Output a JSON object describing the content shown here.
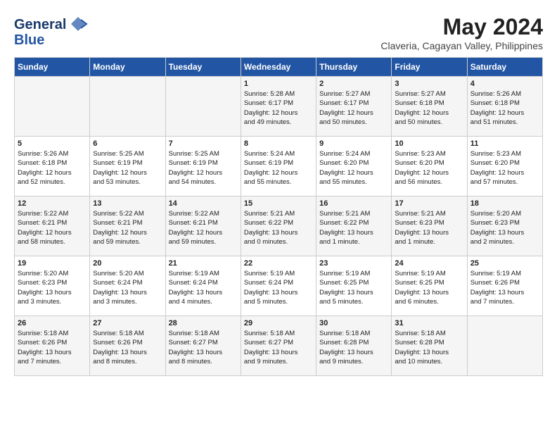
{
  "header": {
    "logo_line1": "General",
    "logo_line2": "Blue",
    "month_year": "May 2024",
    "location": "Claveria, Cagayan Valley, Philippines"
  },
  "days_of_week": [
    "Sunday",
    "Monday",
    "Tuesday",
    "Wednesday",
    "Thursday",
    "Friday",
    "Saturday"
  ],
  "weeks": [
    [
      {
        "day": "",
        "info": ""
      },
      {
        "day": "",
        "info": ""
      },
      {
        "day": "",
        "info": ""
      },
      {
        "day": "1",
        "info": "Sunrise: 5:28 AM\nSunset: 6:17 PM\nDaylight: 12 hours\nand 49 minutes."
      },
      {
        "day": "2",
        "info": "Sunrise: 5:27 AM\nSunset: 6:17 PM\nDaylight: 12 hours\nand 50 minutes."
      },
      {
        "day": "3",
        "info": "Sunrise: 5:27 AM\nSunset: 6:18 PM\nDaylight: 12 hours\nand 50 minutes."
      },
      {
        "day": "4",
        "info": "Sunrise: 5:26 AM\nSunset: 6:18 PM\nDaylight: 12 hours\nand 51 minutes."
      }
    ],
    [
      {
        "day": "5",
        "info": "Sunrise: 5:26 AM\nSunset: 6:18 PM\nDaylight: 12 hours\nand 52 minutes."
      },
      {
        "day": "6",
        "info": "Sunrise: 5:25 AM\nSunset: 6:19 PM\nDaylight: 12 hours\nand 53 minutes."
      },
      {
        "day": "7",
        "info": "Sunrise: 5:25 AM\nSunset: 6:19 PM\nDaylight: 12 hours\nand 54 minutes."
      },
      {
        "day": "8",
        "info": "Sunrise: 5:24 AM\nSunset: 6:19 PM\nDaylight: 12 hours\nand 55 minutes."
      },
      {
        "day": "9",
        "info": "Sunrise: 5:24 AM\nSunset: 6:20 PM\nDaylight: 12 hours\nand 55 minutes."
      },
      {
        "day": "10",
        "info": "Sunrise: 5:23 AM\nSunset: 6:20 PM\nDaylight: 12 hours\nand 56 minutes."
      },
      {
        "day": "11",
        "info": "Sunrise: 5:23 AM\nSunset: 6:20 PM\nDaylight: 12 hours\nand 57 minutes."
      }
    ],
    [
      {
        "day": "12",
        "info": "Sunrise: 5:22 AM\nSunset: 6:21 PM\nDaylight: 12 hours\nand 58 minutes."
      },
      {
        "day": "13",
        "info": "Sunrise: 5:22 AM\nSunset: 6:21 PM\nDaylight: 12 hours\nand 59 minutes."
      },
      {
        "day": "14",
        "info": "Sunrise: 5:22 AM\nSunset: 6:21 PM\nDaylight: 12 hours\nand 59 minutes."
      },
      {
        "day": "15",
        "info": "Sunrise: 5:21 AM\nSunset: 6:22 PM\nDaylight: 13 hours\nand 0 minutes."
      },
      {
        "day": "16",
        "info": "Sunrise: 5:21 AM\nSunset: 6:22 PM\nDaylight: 13 hours\nand 1 minute."
      },
      {
        "day": "17",
        "info": "Sunrise: 5:21 AM\nSunset: 6:23 PM\nDaylight: 13 hours\nand 1 minute."
      },
      {
        "day": "18",
        "info": "Sunrise: 5:20 AM\nSunset: 6:23 PM\nDaylight: 13 hours\nand 2 minutes."
      }
    ],
    [
      {
        "day": "19",
        "info": "Sunrise: 5:20 AM\nSunset: 6:23 PM\nDaylight: 13 hours\nand 3 minutes."
      },
      {
        "day": "20",
        "info": "Sunrise: 5:20 AM\nSunset: 6:24 PM\nDaylight: 13 hours\nand 3 minutes."
      },
      {
        "day": "21",
        "info": "Sunrise: 5:19 AM\nSunset: 6:24 PM\nDaylight: 13 hours\nand 4 minutes."
      },
      {
        "day": "22",
        "info": "Sunrise: 5:19 AM\nSunset: 6:24 PM\nDaylight: 13 hours\nand 5 minutes."
      },
      {
        "day": "23",
        "info": "Sunrise: 5:19 AM\nSunset: 6:25 PM\nDaylight: 13 hours\nand 5 minutes."
      },
      {
        "day": "24",
        "info": "Sunrise: 5:19 AM\nSunset: 6:25 PM\nDaylight: 13 hours\nand 6 minutes."
      },
      {
        "day": "25",
        "info": "Sunrise: 5:19 AM\nSunset: 6:26 PM\nDaylight: 13 hours\nand 7 minutes."
      }
    ],
    [
      {
        "day": "26",
        "info": "Sunrise: 5:18 AM\nSunset: 6:26 PM\nDaylight: 13 hours\nand 7 minutes."
      },
      {
        "day": "27",
        "info": "Sunrise: 5:18 AM\nSunset: 6:26 PM\nDaylight: 13 hours\nand 8 minutes."
      },
      {
        "day": "28",
        "info": "Sunrise: 5:18 AM\nSunset: 6:27 PM\nDaylight: 13 hours\nand 8 minutes."
      },
      {
        "day": "29",
        "info": "Sunrise: 5:18 AM\nSunset: 6:27 PM\nDaylight: 13 hours\nand 9 minutes."
      },
      {
        "day": "30",
        "info": "Sunrise: 5:18 AM\nSunset: 6:28 PM\nDaylight: 13 hours\nand 9 minutes."
      },
      {
        "day": "31",
        "info": "Sunrise: 5:18 AM\nSunset: 6:28 PM\nDaylight: 13 hours\nand 10 minutes."
      },
      {
        "day": "",
        "info": ""
      }
    ]
  ]
}
